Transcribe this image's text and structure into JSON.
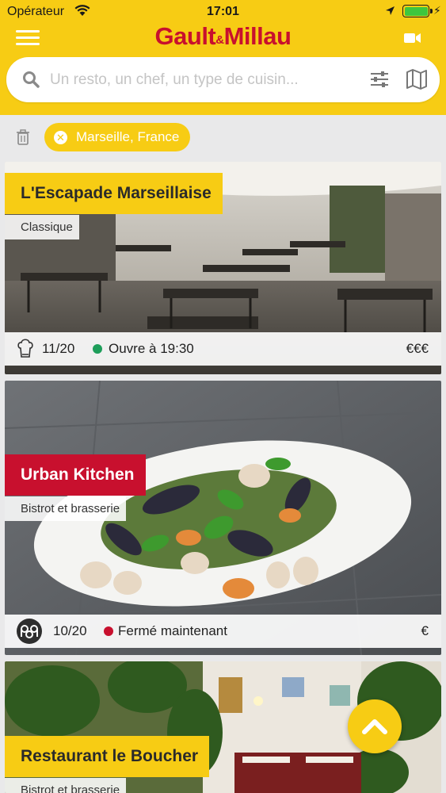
{
  "status_bar": {
    "carrier": "Opérateur",
    "time": "17:01"
  },
  "header": {
    "logo_part1": "Gault",
    "logo_amp": "&",
    "logo_part2": "Millau"
  },
  "search": {
    "placeholder": "Un resto, un chef, un type de cuisin..."
  },
  "filters": {
    "active": [
      {
        "label": "Marseille, France"
      }
    ]
  },
  "restaurants": [
    {
      "name": "L'Escapade Marseillaise",
      "category": "Classique",
      "score": "11/20",
      "status": "Ouvre à 19:30",
      "status_color": "#1e9e5a",
      "price": "€€€",
      "badge_color": "#f7cc14",
      "name_color": "#2a2a2a",
      "icon": "toque-icon"
    },
    {
      "name": "Urban Kitchen",
      "category": "Bistrot et brasserie",
      "score": "10/20",
      "status": "Fermé maintenant",
      "status_color": "#c8102e",
      "price": "€",
      "badge_color": "#c8102e",
      "name_color": "#ffffff",
      "icon": "pop-icon"
    },
    {
      "name": "Restaurant le Boucher",
      "category": "Bistrot et brasserie",
      "badge_color": "#f7cc14",
      "name_color": "#2a2a2a"
    }
  ],
  "colors": {
    "brand_yellow": "#f7cc14",
    "brand_red": "#c8102e"
  }
}
